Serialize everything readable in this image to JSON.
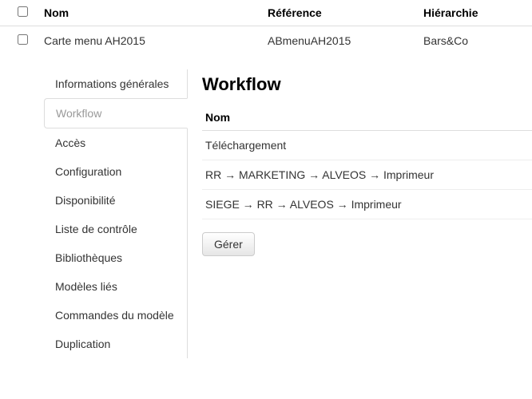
{
  "table": {
    "headers": {
      "nom": "Nom",
      "reference": "Référence",
      "hierarchie": "Hiérarchie"
    },
    "rows": [
      {
        "nom": "Carte menu AH2015",
        "reference": "ABmenuAH2015",
        "hierarchie": "Bars&Co"
      }
    ]
  },
  "sidebar": {
    "items": [
      {
        "label": "Informations générales"
      },
      {
        "label": "Workflow",
        "active": true
      },
      {
        "label": "Accès"
      },
      {
        "label": "Configuration"
      },
      {
        "label": "Disponibilité"
      },
      {
        "label": "Liste de contrôle"
      },
      {
        "label": "Bibliothèques"
      },
      {
        "label": "Modèles liés"
      },
      {
        "label": "Commandes du modèle"
      },
      {
        "label": "Duplication"
      }
    ]
  },
  "content": {
    "title": "Workflow",
    "col_header": "Nom",
    "rows": [
      "Téléchargement",
      "RR → MARKETING → ALVEOS → Imprimeur",
      "SIEGE → RR → ALVEOS → Imprimeur"
    ],
    "manage_button": "Gérer"
  }
}
